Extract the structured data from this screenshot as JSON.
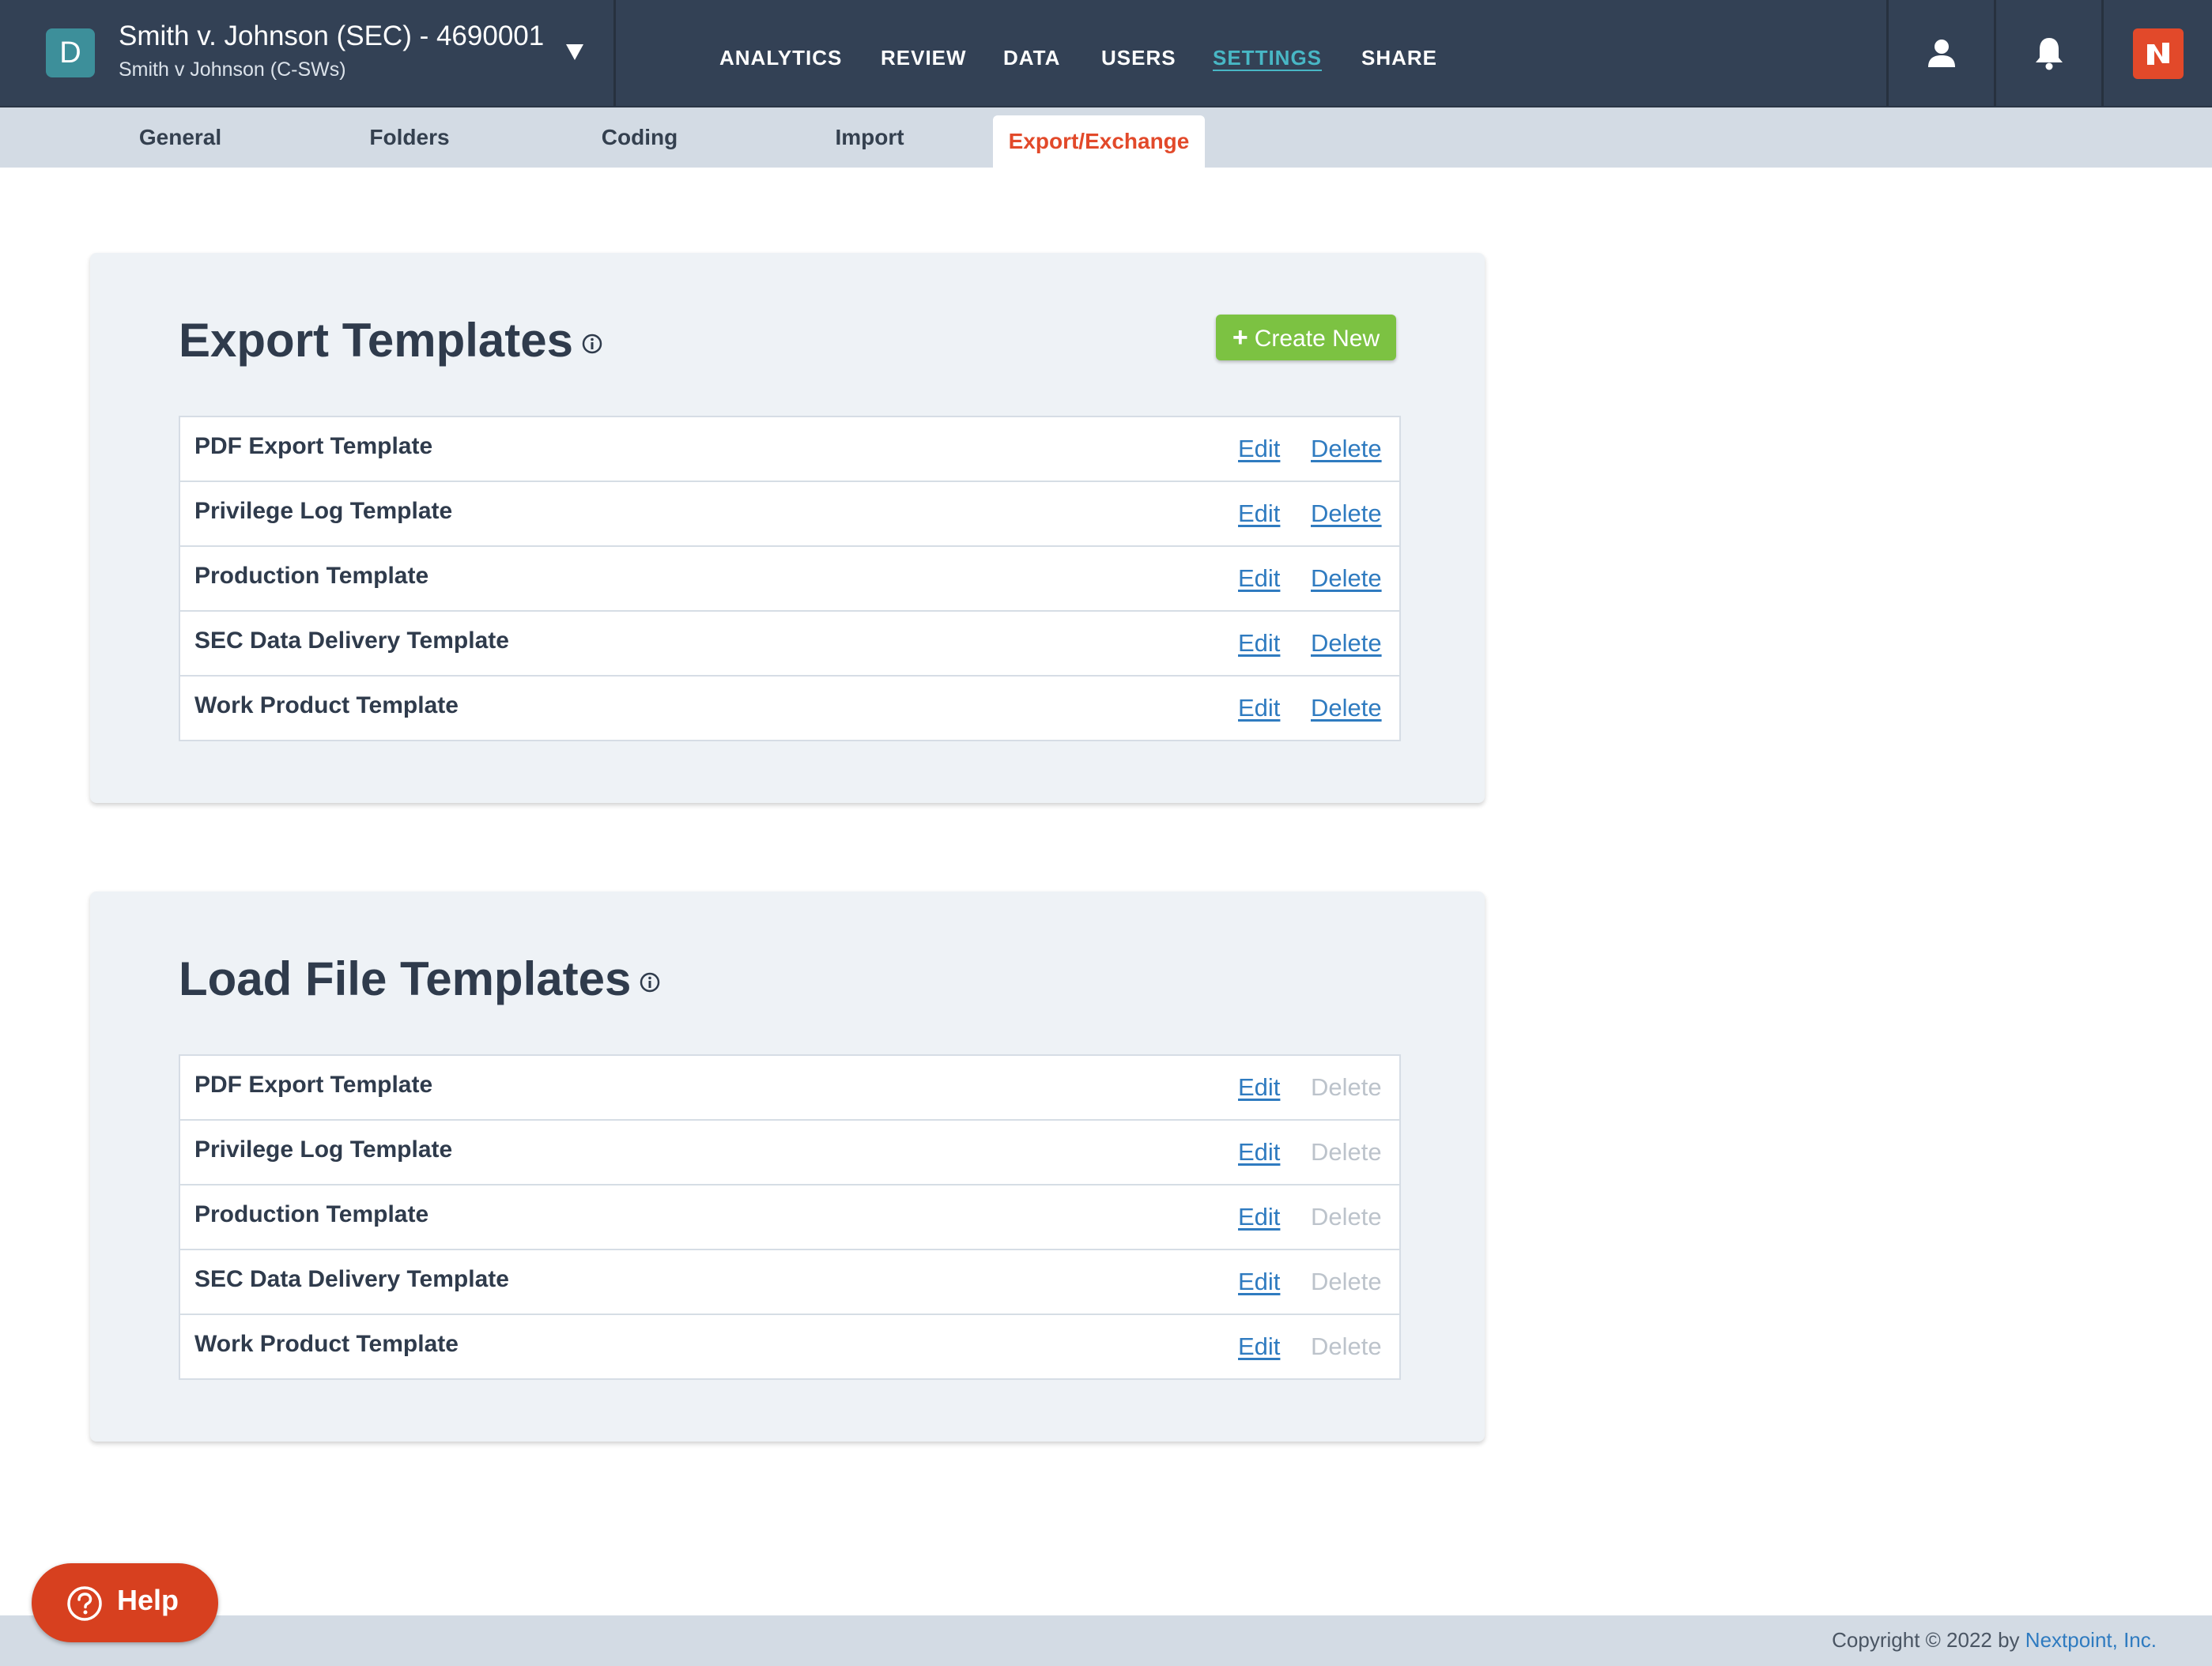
{
  "header": {
    "case_badge": "D",
    "case_title": "Smith v. Johnson (SEC) - 4690001",
    "case_subtitle": "Smith v Johnson (C-SWs)",
    "nav": [
      {
        "label": "ANALYTICS"
      },
      {
        "label": "REVIEW"
      },
      {
        "label": "DATA"
      },
      {
        "label": "USERS"
      },
      {
        "label": "SETTINGS",
        "active": true
      },
      {
        "label": "SHARE"
      }
    ],
    "icons": [
      "user-icon",
      "bell-icon",
      "nextpoint-logo-icon"
    ]
  },
  "tabs": [
    {
      "label": "General"
    },
    {
      "label": "Folders"
    },
    {
      "label": "Coding"
    },
    {
      "label": "Import"
    },
    {
      "label": "Export/Exchange",
      "active": true
    }
  ],
  "export_templates": {
    "title": "Export Templates",
    "create_label": "Create New",
    "rows": [
      {
        "name": "PDF Export Template",
        "edit": "Edit",
        "delete": "Delete"
      },
      {
        "name": "Privilege Log Template",
        "edit": "Edit",
        "delete": "Delete"
      },
      {
        "name": "Production Template",
        "edit": "Edit",
        "delete": "Delete"
      },
      {
        "name": "SEC Data Delivery Template",
        "edit": "Edit",
        "delete": "Delete"
      },
      {
        "name": "Work Product Template",
        "edit": "Edit",
        "delete": "Delete"
      }
    ]
  },
  "load_file_templates": {
    "title": "Load File Templates",
    "rows": [
      {
        "name": "PDF Export Template",
        "edit": "Edit",
        "delete": "Delete"
      },
      {
        "name": "Privilege Log Template",
        "edit": "Edit",
        "delete": "Delete"
      },
      {
        "name": "Production Template",
        "edit": "Edit",
        "delete": "Delete"
      },
      {
        "name": "SEC Data Delivery Template",
        "edit": "Edit",
        "delete": "Delete"
      },
      {
        "name": "Work Product Template",
        "edit": "Edit",
        "delete": "Delete"
      }
    ]
  },
  "help": {
    "label": "Help"
  },
  "footer": {
    "copyright": "Copyright © 2022 by",
    "company": "Nextpoint, Inc."
  },
  "colors": {
    "topbar": "#334155",
    "accent_active_nav": "#48b7c5",
    "active_tab": "#e2492a",
    "create_button": "#7cc242",
    "link": "#2f7bc0",
    "help_button": "#d7401f"
  }
}
